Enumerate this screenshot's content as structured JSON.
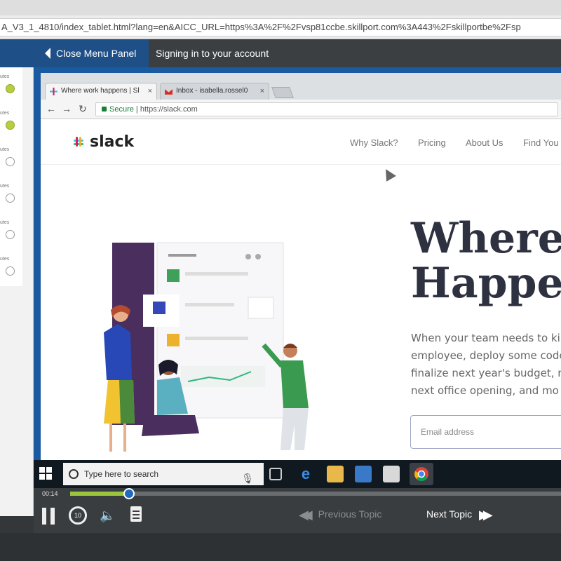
{
  "browser": {
    "url": "A_V3_1_4810/index_tablet.html?lang=en&AICC_URL=https%3A%2F%2Fvsp81ccbe.skillport.com%3A443%2Fskillportbe%2Fsp"
  },
  "header": {
    "close_menu_label": "Close Menu Panel",
    "title": "Signing in to your account"
  },
  "side_panel": {
    "items": [
      {
        "label": "utes",
        "status": "done"
      },
      {
        "label": "utes",
        "status": "done"
      },
      {
        "label": "utes",
        "status": "empty"
      },
      {
        "label": "utes",
        "status": "empty"
      },
      {
        "label": "utes",
        "status": "empty"
      },
      {
        "label": "utes",
        "status": "empty"
      }
    ]
  },
  "inner_browser": {
    "tabs": [
      {
        "label": "Where work happens | Sl"
      },
      {
        "label": "Inbox - isabella.rossel0"
      }
    ],
    "secure_label": "Secure",
    "url": "https://slack.com"
  },
  "slack": {
    "logo_text": "slack",
    "nav": [
      "Why Slack?",
      "Pricing",
      "About Us",
      "Find You"
    ],
    "hero_line1": "Where W",
    "hero_line2": "Happen",
    "sub_lines": [
      "When your team needs to ki",
      "employee, deploy some code",
      "finalize next year's budget, n",
      "next office opening, and mo"
    ],
    "email_placeholder": "Email address"
  },
  "taskbar": {
    "search_placeholder": "Type here to search"
  },
  "controls": {
    "time": "00:14",
    "progress": 0.12,
    "replay_label": "10",
    "prev_label": "Previous Topic",
    "next_label": "Next Topic"
  },
  "colors": {
    "accent_blue": "#1f4f87",
    "progress_green": "#9bc53d",
    "done_dot": "#b6cf3e"
  }
}
